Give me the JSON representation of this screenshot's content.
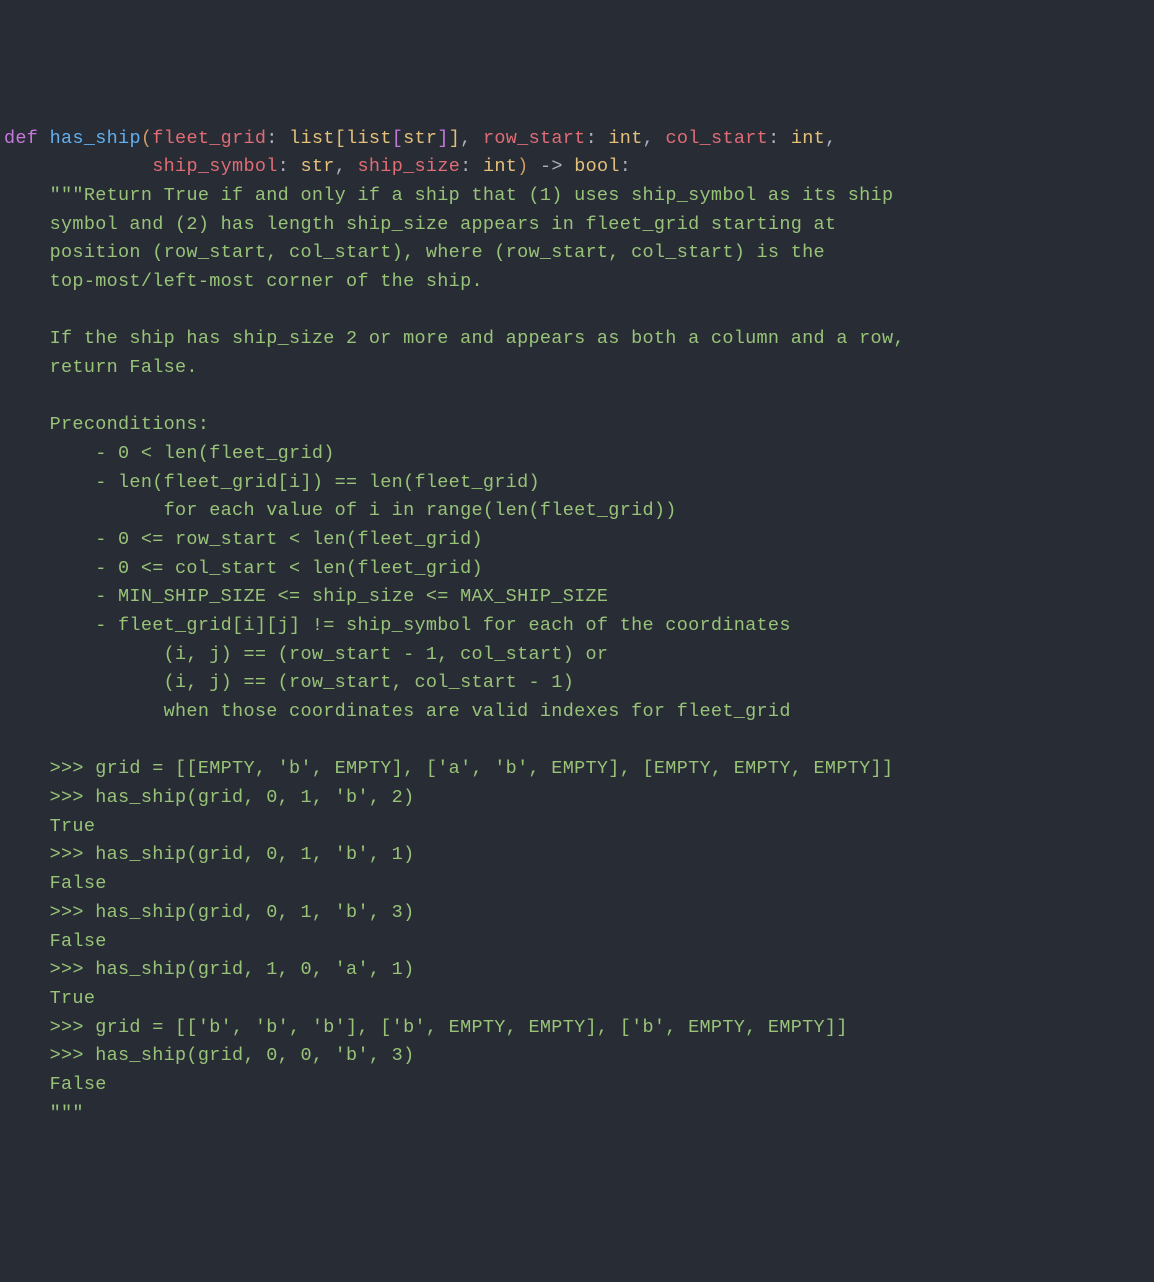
{
  "code": {
    "def": "def",
    "fn": "has_ship",
    "sig_part1_open": "(",
    "p1": "fleet_grid",
    "colon": ":",
    "sp": " ",
    "list": "list",
    "lb": "[",
    "rb": "]",
    "str": "str",
    "comma": ",",
    "p2": "row_start",
    "int": "int",
    "p3": "col_start",
    "p4": "ship_symbol",
    "p5": "ship_size",
    "arrow": "->",
    "bool": "bool",
    "sig_close": ")",
    "endcolon": ":",
    "doc_open": "\"\"\"",
    "doc_l1": "Return True if and only if a ship that (1) uses ship_symbol as its ship",
    "doc_l2": "    symbol and (2) has length ship_size appears in fleet_grid starting at",
    "doc_l3": "    position (row_start, col_start), where (row_start, col_start) is the",
    "doc_l4": "    top-most/left-most corner of the ship.",
    "doc_l5": "    If the ship has ship_size 2 or more and appears as both a column and a row,",
    "doc_l6": "    return False.",
    "doc_l7": "    Preconditions:",
    "doc_l8": "        - 0 < len(fleet_grid)",
    "doc_l9": "        - len(fleet_grid[i]) == len(fleet_grid)",
    "doc_l10": "              for each value of i in range(len(fleet_grid))",
    "doc_l11": "        - 0 <= row_start < len(fleet_grid)",
    "doc_l12": "        - 0 <= col_start < len(fleet_grid)",
    "doc_l13": "        - MIN_SHIP_SIZE <= ship_size <= MAX_SHIP_SIZE",
    "doc_l14": "        - fleet_grid[i][j] != ship_symbol for each of the coordinates",
    "doc_l15": "              (i, j) == (row_start - 1, col_start) or",
    "doc_l16": "              (i, j) == (row_start, col_start - 1)",
    "doc_l17": "              when those coordinates are valid indexes for fleet_grid",
    "doc_l18": "    >>> grid = [[EMPTY, 'b', EMPTY], ['a', 'b', EMPTY], [EMPTY, EMPTY, EMPTY]]",
    "doc_l19": "    >>> has_ship(grid, 0, 1, 'b', 2)",
    "doc_l20": "    True",
    "doc_l21": "    >>> has_ship(grid, 0, 1, 'b', 1)",
    "doc_l22": "    False",
    "doc_l23": "    >>> has_ship(grid, 0, 1, 'b', 3)",
    "doc_l24": "    False",
    "doc_l25": "    >>> has_ship(grid, 1, 0, 'a', 1)",
    "doc_l26": "    True",
    "doc_l27": "    >>> grid = [['b', 'b', 'b'], ['b', EMPTY, EMPTY], ['b', EMPTY, EMPTY]]",
    "doc_l28": "    >>> has_ship(grid, 0, 0, 'b', 3)",
    "doc_l29": "    False",
    "doc_close": "    \"\"\""
  }
}
